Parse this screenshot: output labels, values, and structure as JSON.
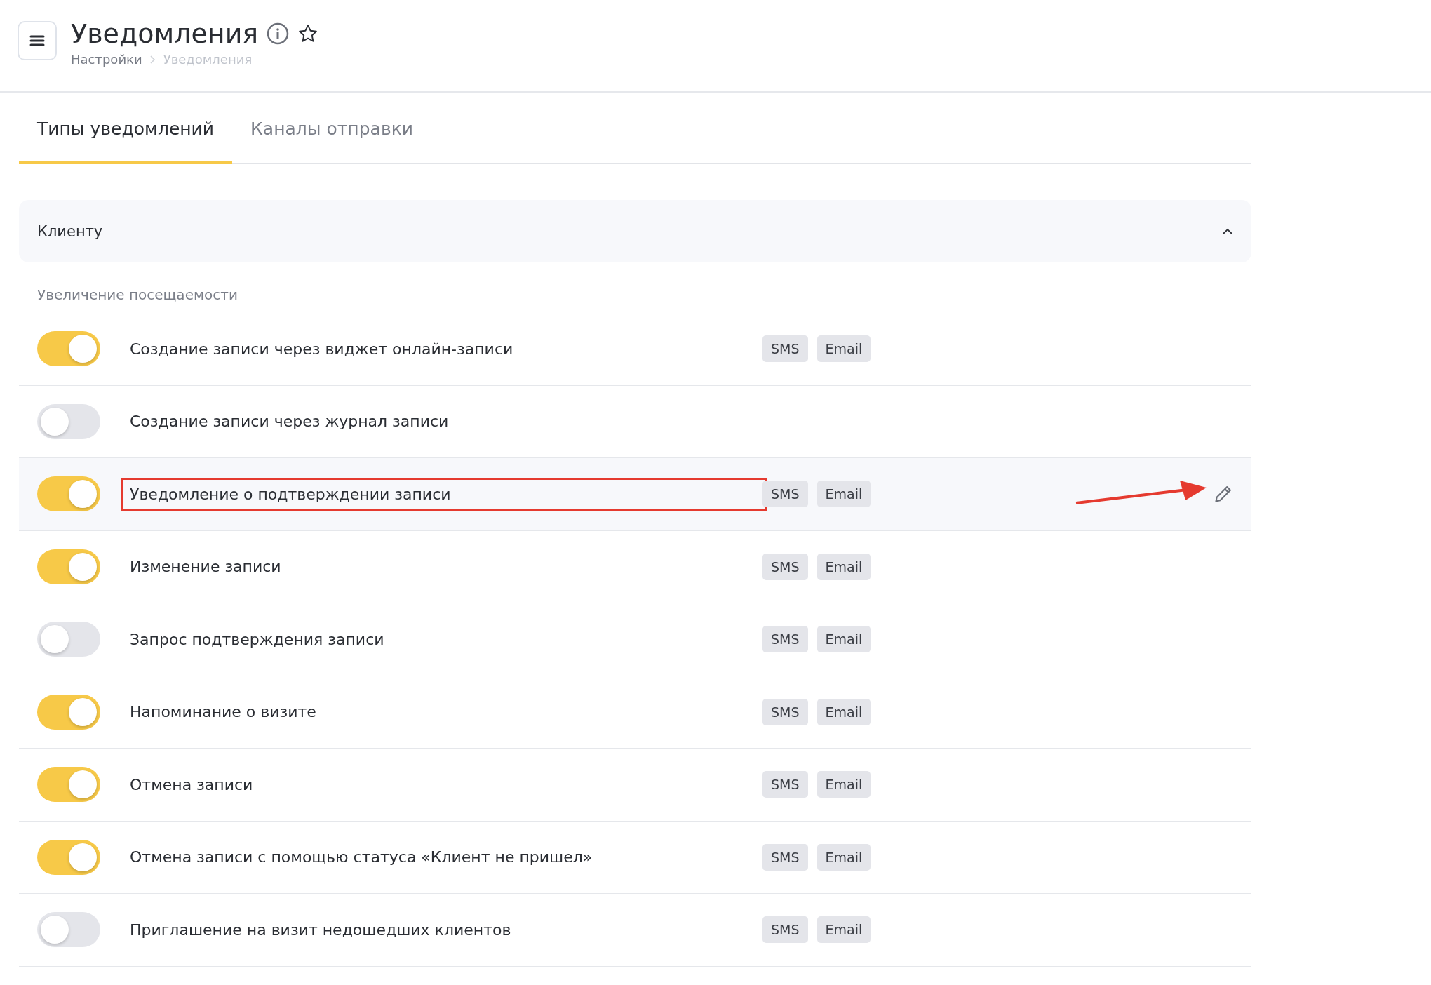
{
  "header": {
    "title": "Уведомления",
    "breadcrumbs": [
      {
        "label": "Настройки",
        "current": false
      },
      {
        "label": "Уведомления",
        "current": true
      }
    ]
  },
  "tabs": [
    {
      "label": "Типы уведомлений",
      "selected": true
    },
    {
      "label": "Каналы отправки",
      "selected": false
    }
  ],
  "section": {
    "title": "Клиенту",
    "expanded": true,
    "subheading": "Увеличение посещаемости",
    "rows": [
      {
        "label": "Создание записи через виджет онлайн-записи",
        "on": true,
        "hovered": false,
        "outlined": false,
        "channels": [
          "SMS",
          "Email"
        ]
      },
      {
        "label": "Создание записи через журнал записи",
        "on": false,
        "hovered": false,
        "outlined": false,
        "channels": []
      },
      {
        "label": "Уведомление о подтверждении записи",
        "on": true,
        "hovered": true,
        "outlined": true,
        "channels": [
          "SMS",
          "Email"
        ]
      },
      {
        "label": "Изменение записи",
        "on": true,
        "hovered": false,
        "outlined": false,
        "channels": [
          "SMS",
          "Email"
        ]
      },
      {
        "label": "Запрос подтверждения записи",
        "on": false,
        "hovered": false,
        "outlined": false,
        "channels": [
          "SMS",
          "Email"
        ]
      },
      {
        "label": "Напоминание о визите",
        "on": true,
        "hovered": false,
        "outlined": false,
        "channels": [
          "SMS",
          "Email"
        ]
      },
      {
        "label": "Отмена записи",
        "on": true,
        "hovered": false,
        "outlined": false,
        "channels": [
          "SMS",
          "Email"
        ]
      },
      {
        "label": "Отмена записи с помощью статуса «Клиент не пришел»",
        "on": true,
        "hovered": false,
        "outlined": false,
        "channels": [
          "SMS",
          "Email"
        ]
      },
      {
        "label": "Приглашение на визит недошедших клиентов",
        "on": false,
        "hovered": false,
        "outlined": false,
        "channels": [
          "SMS",
          "Email"
        ]
      }
    ]
  }
}
